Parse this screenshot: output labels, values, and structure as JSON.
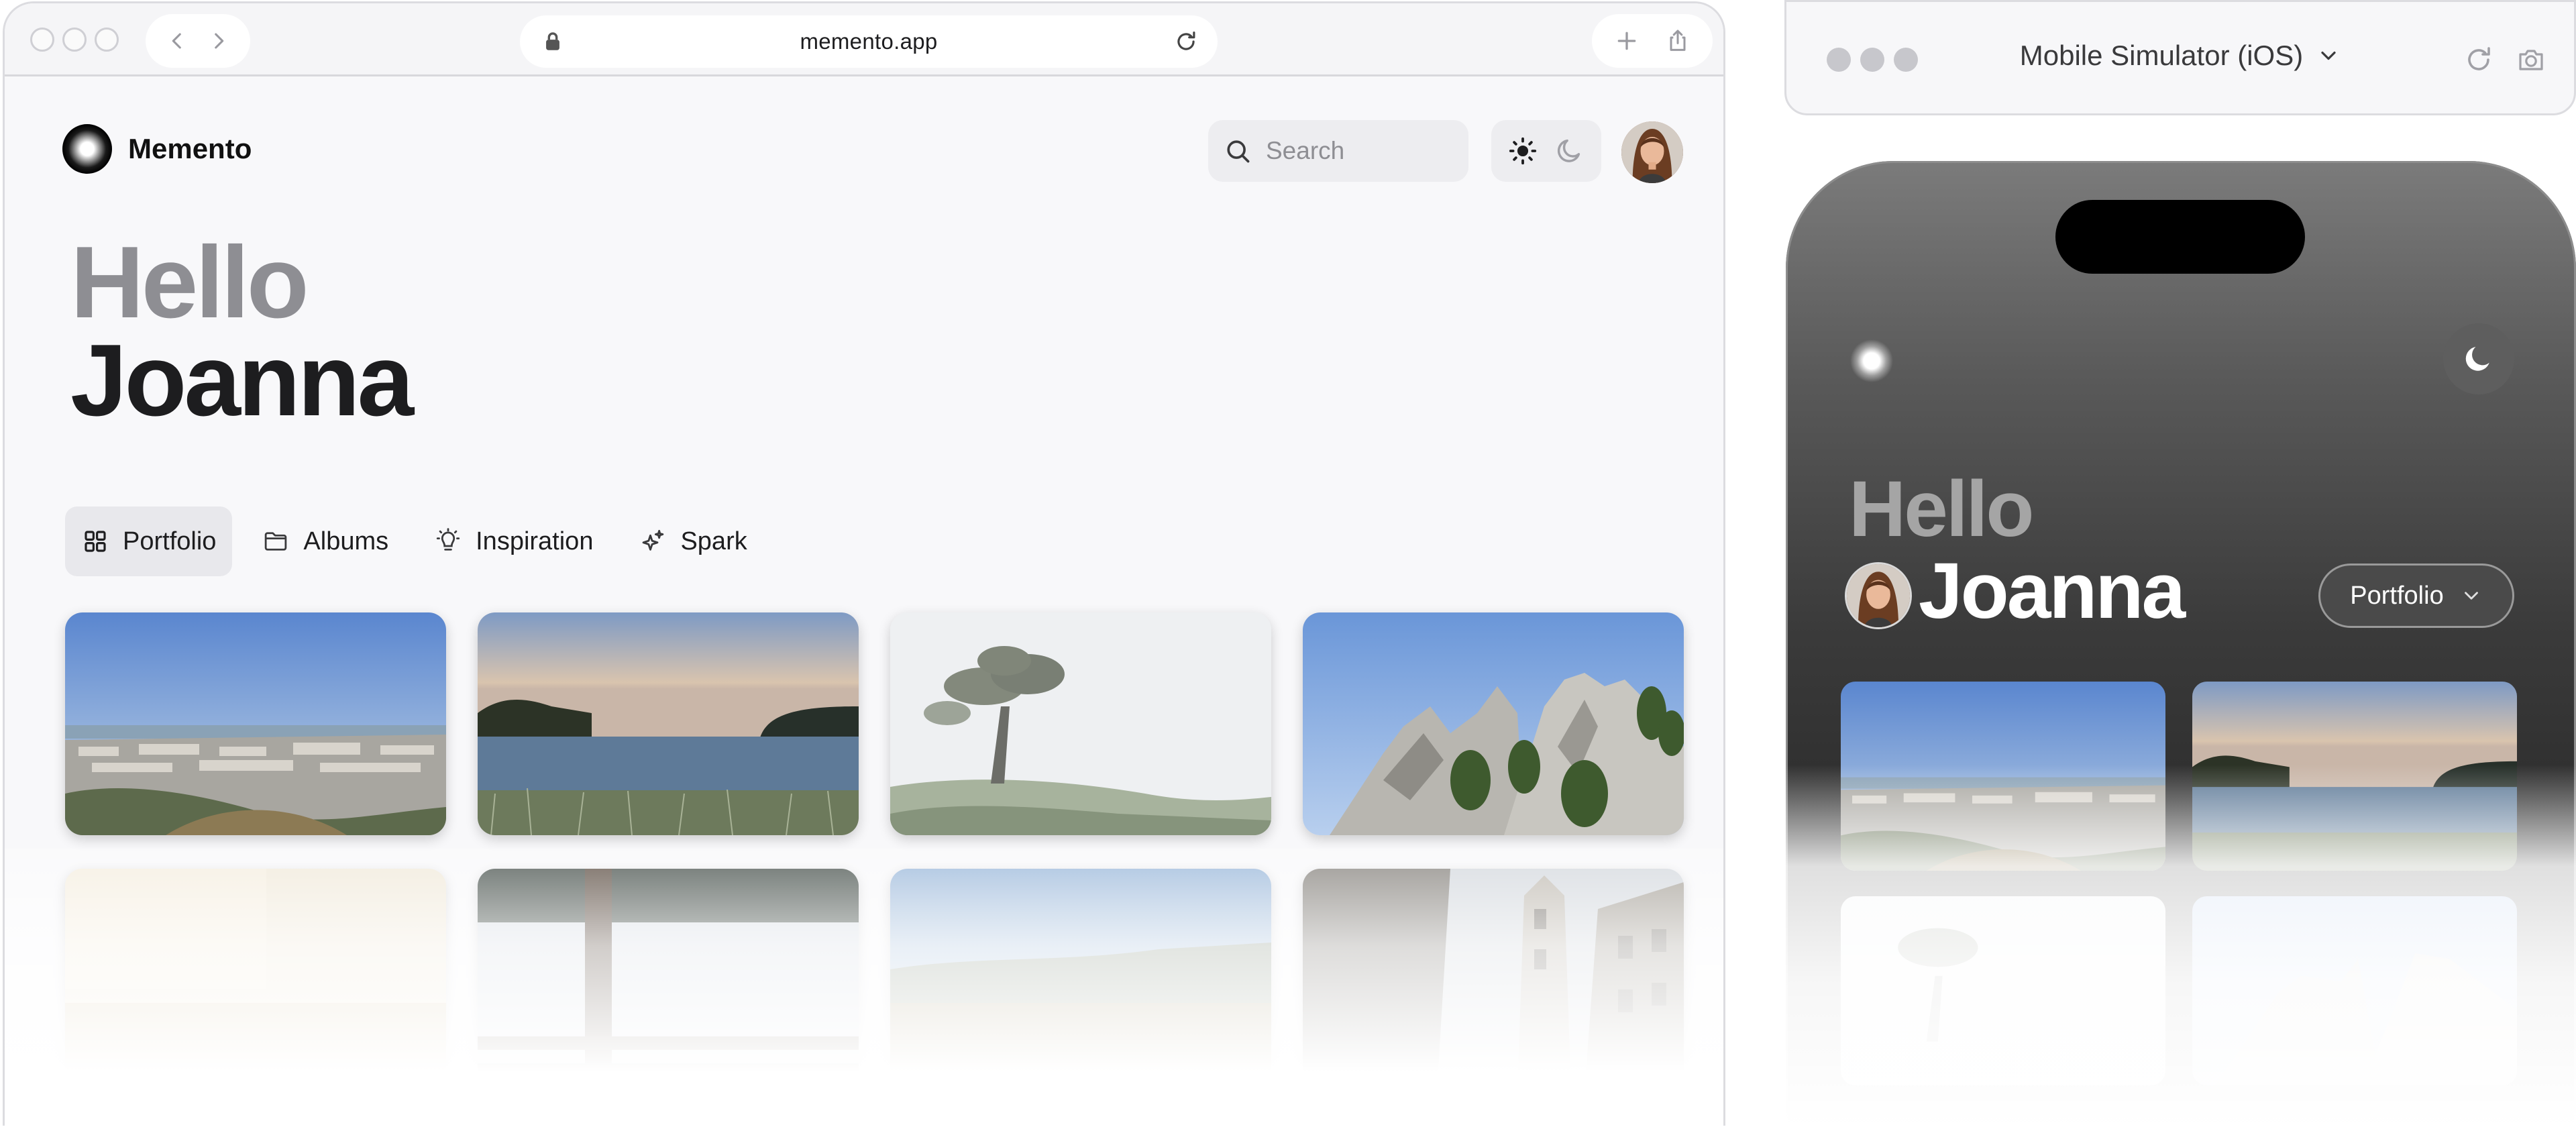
{
  "browser": {
    "url": "memento.app",
    "colors": {
      "chrome_bg": "#f5f5f7",
      "page_bg": "#f8f8fa",
      "accent": "#1d1d1f"
    }
  },
  "app": {
    "name": "Memento",
    "search_placeholder": "Search",
    "greeting": "Hello",
    "user_name": "Joanna",
    "tabs": [
      {
        "label": "Portfolio",
        "icon": "grid-icon",
        "active": true
      },
      {
        "label": "Albums",
        "icon": "folder-icon",
        "active": false
      },
      {
        "label": "Inspiration",
        "icon": "lightbulb-icon",
        "active": false
      },
      {
        "label": "Spark",
        "icon": "sparkles-icon",
        "active": false
      }
    ],
    "photos": [
      {
        "subject": "city-view"
      },
      {
        "subject": "lake-sunset"
      },
      {
        "subject": "foggy-tree"
      },
      {
        "subject": "rocky-peaks"
      },
      {
        "subject": "hazy-field"
      },
      {
        "subject": "snow-window"
      },
      {
        "subject": "grass-hills"
      },
      {
        "subject": "old-building"
      }
    ]
  },
  "simulator": {
    "title": "Mobile Simulator (iOS)",
    "greeting": "Hello",
    "user_name": "Joanna",
    "filter_label": "Portfolio",
    "colors": {
      "phone_bg": "#3b3b3b",
      "greeting": "#a5a5a5"
    }
  }
}
